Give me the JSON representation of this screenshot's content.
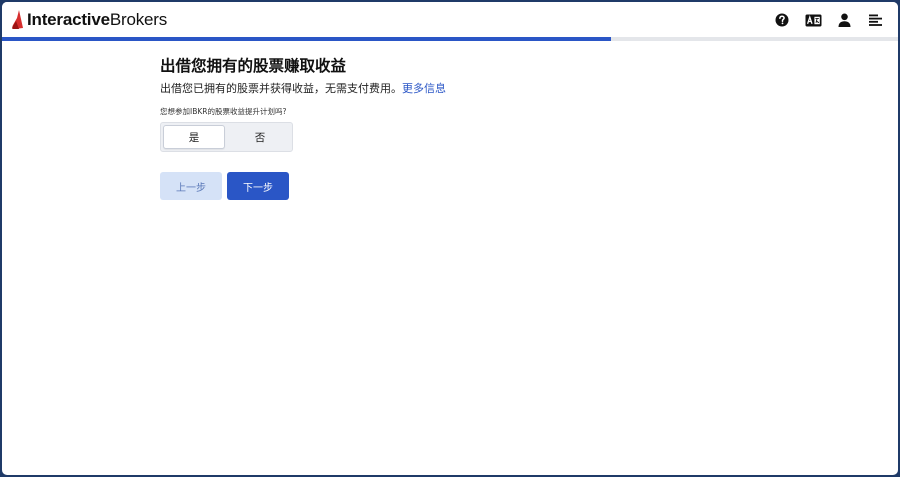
{
  "header": {
    "logo_text_bold": "Interactive",
    "logo_text_regular": "Brokers",
    "icons": [
      "help-icon",
      "translate-icon",
      "user-icon",
      "menu-icon"
    ]
  },
  "progress": {
    "fraction": 0.68,
    "color": "#2a56c6"
  },
  "main": {
    "title": "出借您拥有的股票赚取收益",
    "subtitle": "出借您已拥有的股票并获得收益，无需支付费用。",
    "more_info_link": "更多信息",
    "question": "您想参加IBKR的股票收益提升计划吗?",
    "options": [
      {
        "label": "是",
        "selected": true
      },
      {
        "label": "否",
        "selected": false
      }
    ],
    "back_label": "上一步",
    "next_label": "下一步"
  },
  "colors": {
    "accent": "#2a56c6",
    "logo_red": "#d62e2e",
    "frame": "#1f3a68"
  }
}
